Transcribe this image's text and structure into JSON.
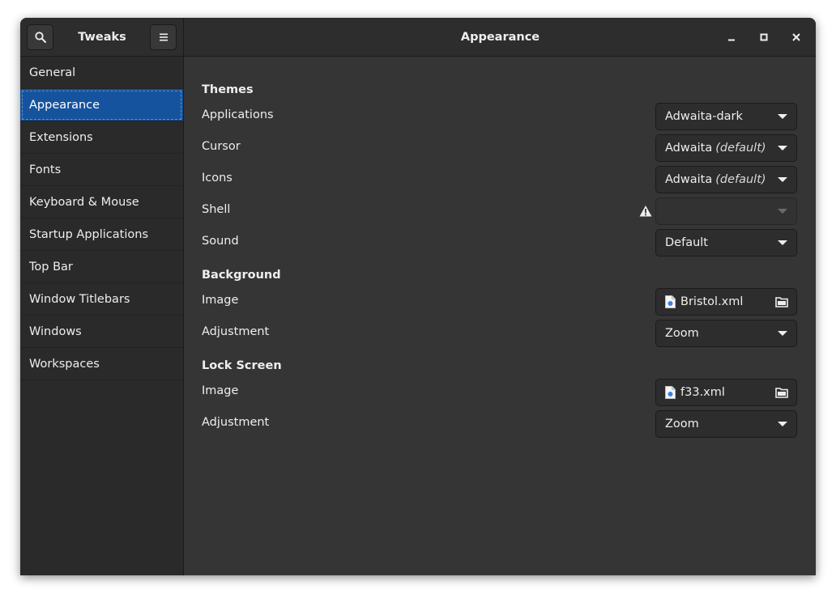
{
  "header": {
    "app_title": "Tweaks",
    "page_title": "Appearance",
    "search_icon": "search-icon",
    "menu_icon": "hamburger-menu-icon"
  },
  "sidebar": {
    "items": [
      {
        "label": "General"
      },
      {
        "label": "Appearance",
        "selected": true
      },
      {
        "label": "Extensions"
      },
      {
        "label": "Fonts"
      },
      {
        "label": "Keyboard & Mouse"
      },
      {
        "label": "Startup Applications"
      },
      {
        "label": "Top Bar"
      },
      {
        "label": "Window Titlebars"
      },
      {
        "label": "Windows"
      },
      {
        "label": "Workspaces"
      }
    ]
  },
  "themes": {
    "heading": "Themes",
    "applications": {
      "label": "Applications",
      "value": "Adwaita-dark"
    },
    "cursor": {
      "label": "Cursor",
      "value": "Adwaita",
      "suffix": "(default)"
    },
    "icons": {
      "label": "Icons",
      "value": "Adwaita",
      "suffix": "(default)"
    },
    "shell": {
      "label": "Shell",
      "value": "",
      "warning_icon": "warning-icon"
    },
    "sound": {
      "label": "Sound",
      "value": "Default"
    }
  },
  "background": {
    "heading": "Background",
    "image": {
      "label": "Image",
      "file": "Bristol.xml"
    },
    "adjustment": {
      "label": "Adjustment",
      "value": "Zoom"
    }
  },
  "lock_screen": {
    "heading": "Lock Screen",
    "image": {
      "label": "Image",
      "file": "f33.xml"
    },
    "adjustment": {
      "label": "Adjustment",
      "value": "Zoom"
    }
  },
  "colors": {
    "accent": "#15539e",
    "window_bg": "#353535",
    "sidebar_bg": "#2a2a2a",
    "headerbar_bg": "#2d2d2d"
  }
}
